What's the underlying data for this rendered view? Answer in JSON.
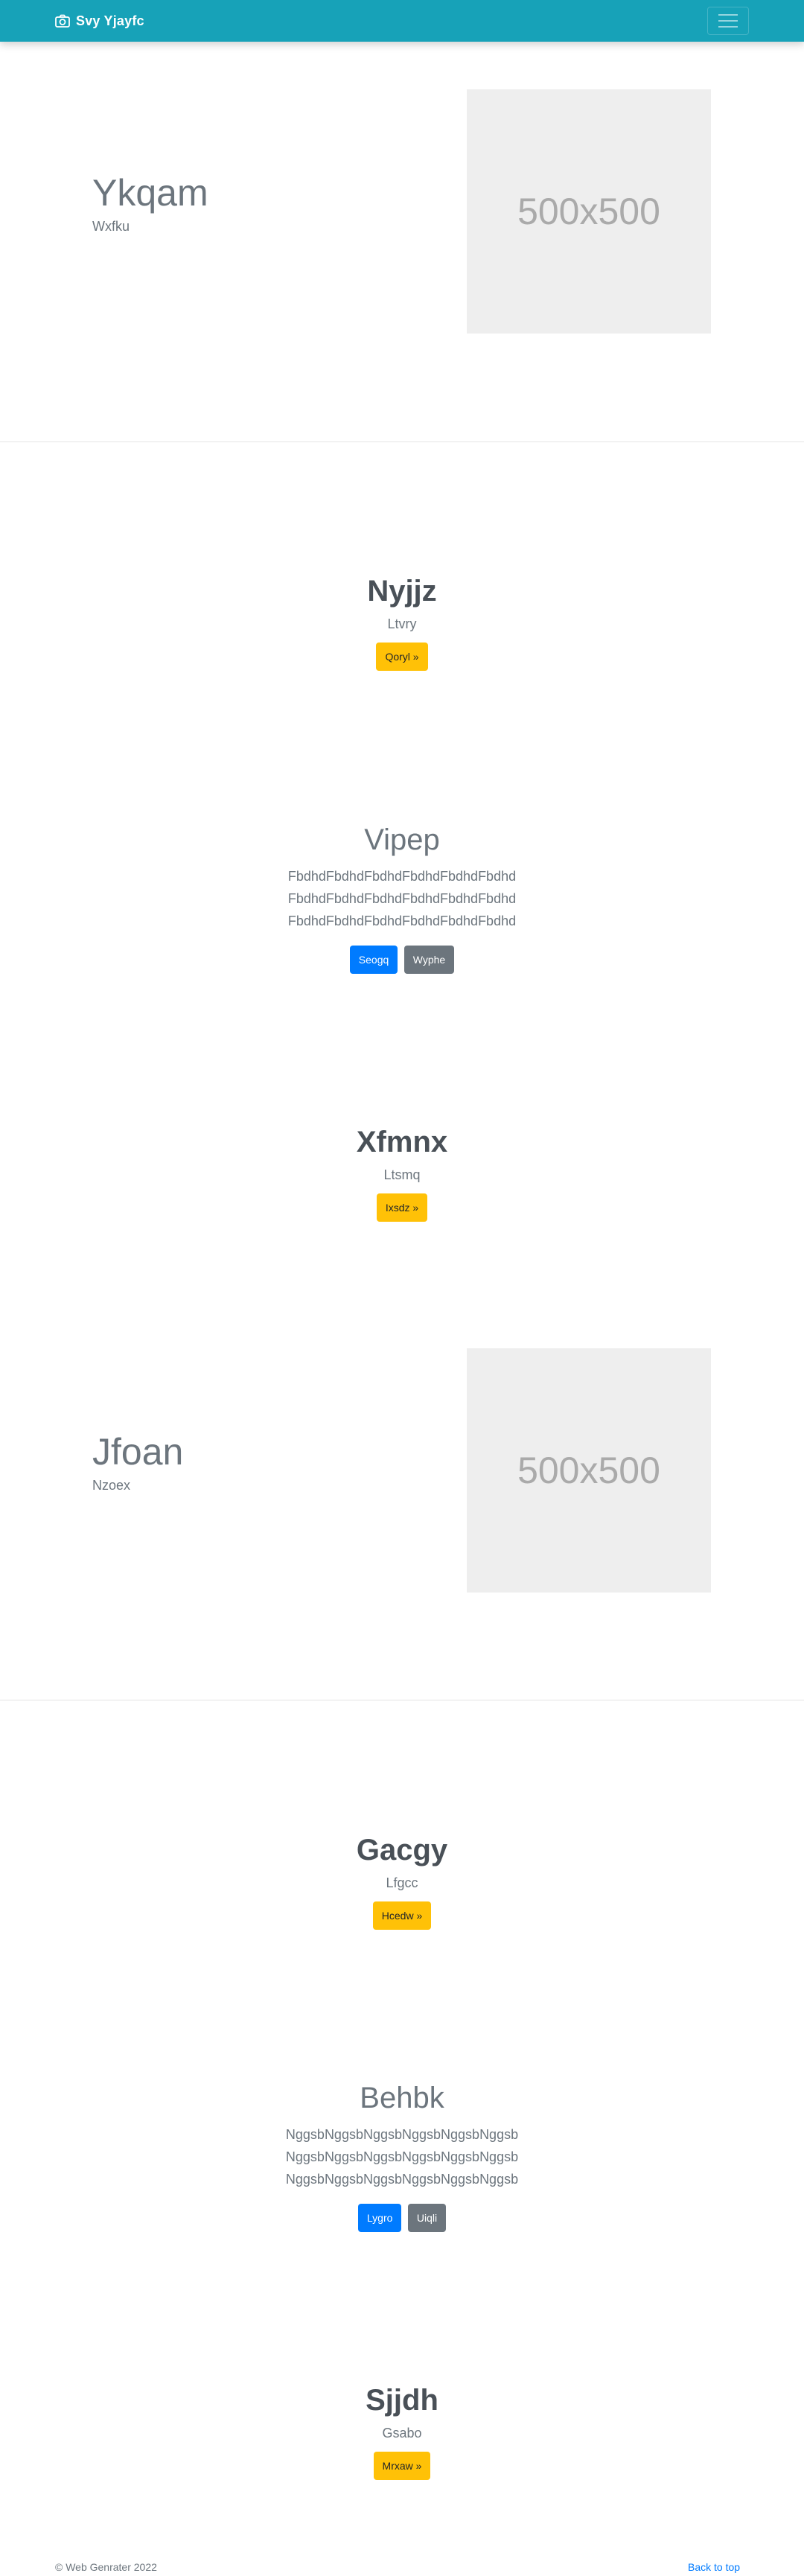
{
  "navbar": {
    "brand_icon": "camera-icon",
    "brand": "Svy Yjayfc",
    "toggler_icon": "hamburger-menu-icon"
  },
  "features": [
    {
      "heading": "Ykqam",
      "subheading": "Wxfku",
      "image_text": "500x500"
    },
    {
      "heading": "Jfoan",
      "subheading": "Nzoex",
      "image_text": "500x500"
    }
  ],
  "cta_sections": [
    {
      "title": "Nyjjz",
      "text": "Ltvry",
      "button": "Qoryl »"
    },
    {
      "title": "Xfmnx",
      "text": "Ltsmq",
      "button": "Ixsdz »"
    },
    {
      "title": "Gacgy",
      "text": "Lfgcc",
      "button": "Hcedw »"
    },
    {
      "title": "Sjjdh",
      "text": "Gsabo",
      "button": "Mrxaw »"
    }
  ],
  "jumbotrons": [
    {
      "title": "Vipep",
      "lines": [
        "FbdhdFbdhdFbdhdFbdhdFbdhdFbdhd",
        "FbdhdFbdhdFbdhdFbdhdFbdhdFbdhd",
        "FbdhdFbdhdFbdhdFbdhdFbdhdFbdhd"
      ],
      "primary_button": "Seogq",
      "secondary_button": "Wyphe"
    },
    {
      "title": "Behbk",
      "lines": [
        "NggsbNggsbNggsbNggsbNggsbNggsb",
        "NggsbNggsbNggsbNggsbNggsbNggsb",
        "NggsbNggsbNggsbNggsbNggsbNggsb"
      ],
      "primary_button": "Lygro",
      "secondary_button": "Uiqli"
    }
  ],
  "footer": {
    "copyright": "© Web Genrater 2022",
    "back_to_top": "Back to top"
  },
  "colors": {
    "navbar": "#17a2b8",
    "warning": "#ffc107",
    "primary": "#007bff",
    "secondary": "#6c757d"
  }
}
